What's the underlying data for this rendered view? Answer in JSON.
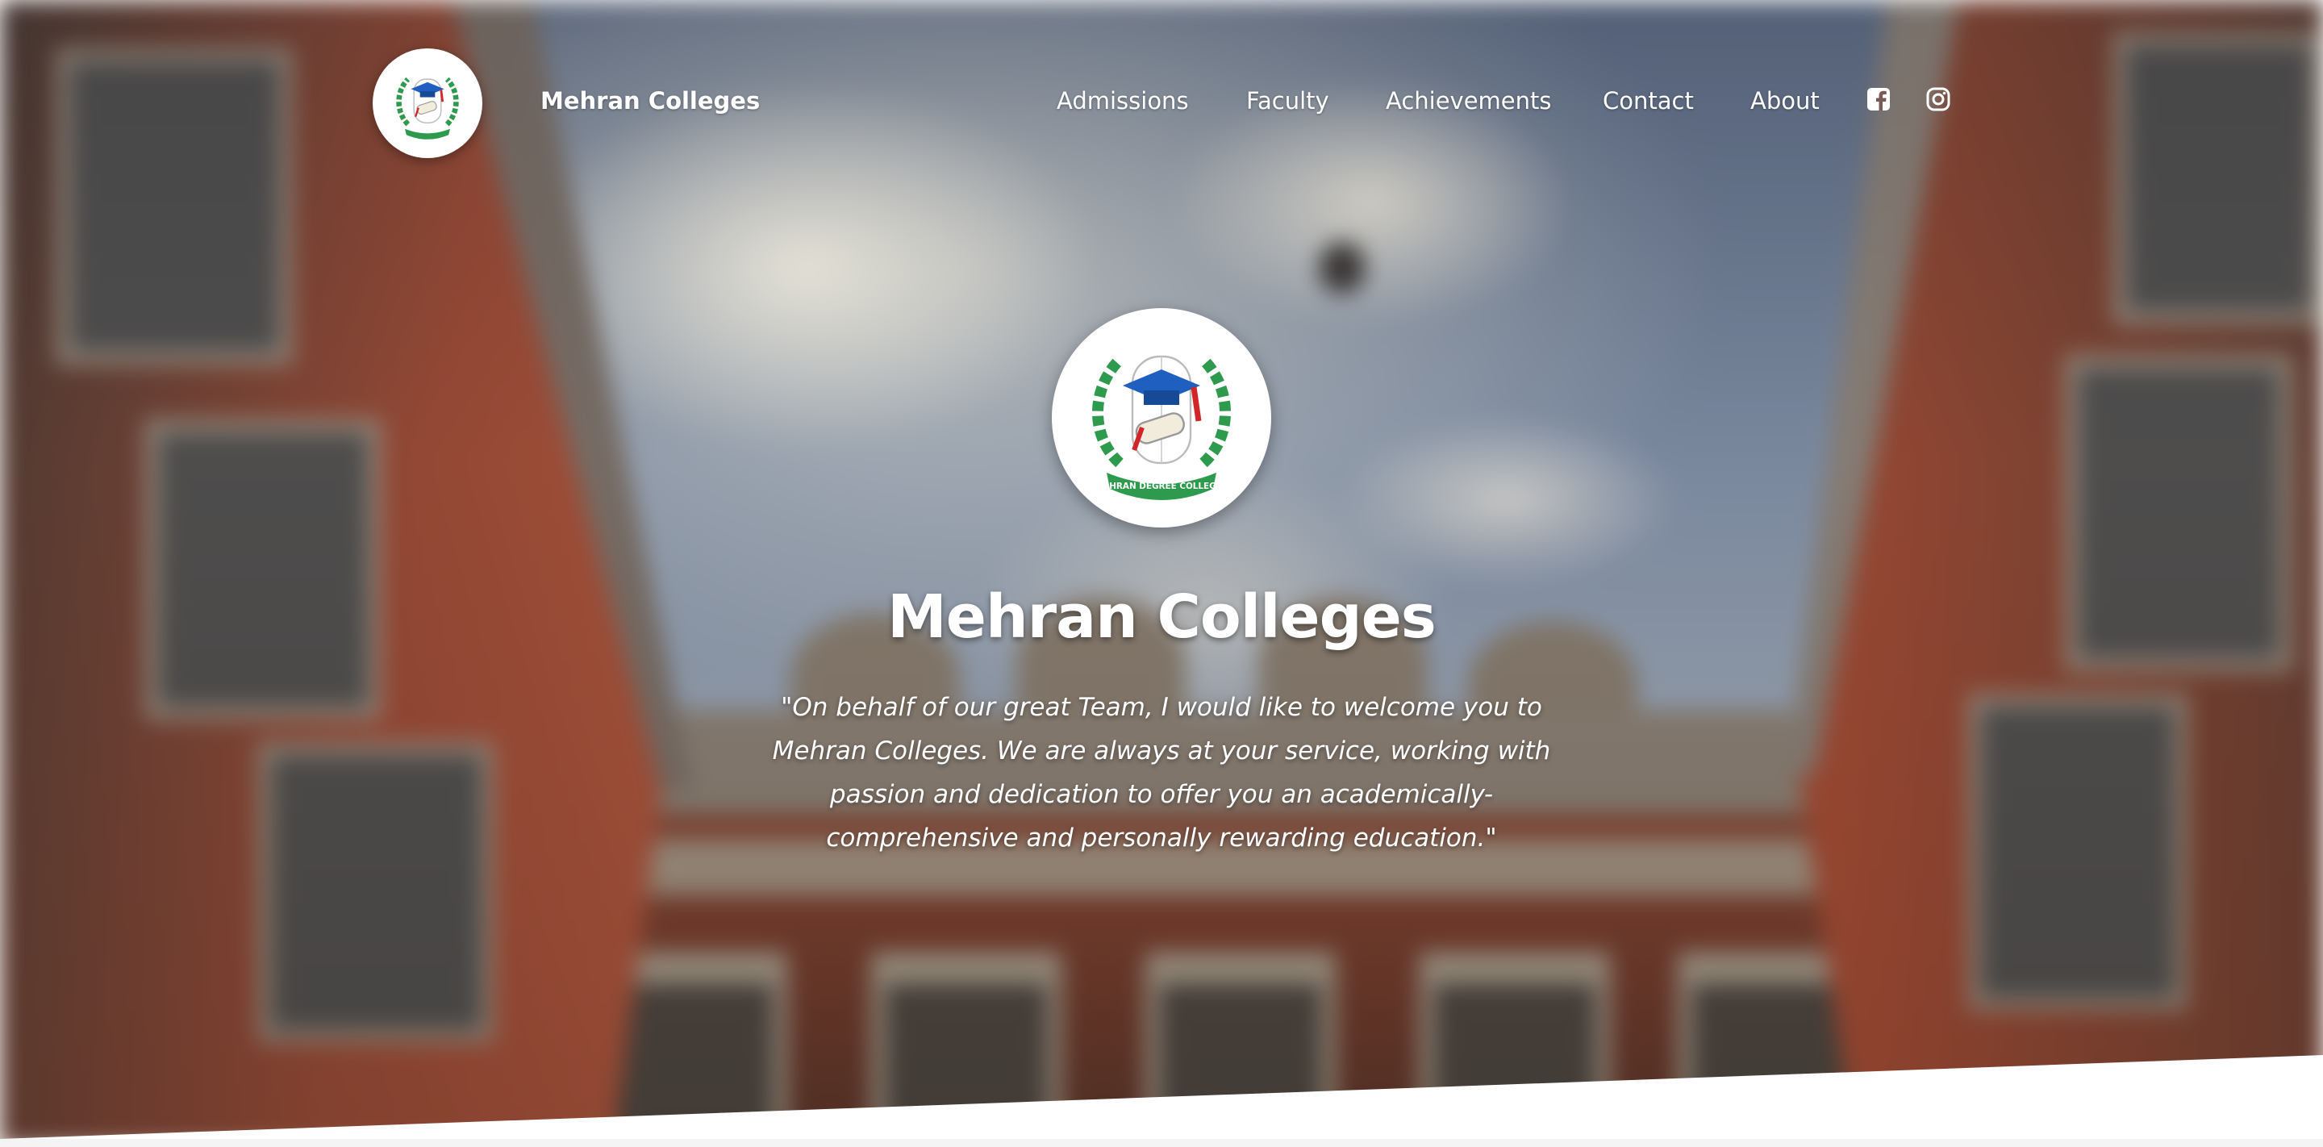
{
  "navbar": {
    "brand": "Mehran Colleges",
    "logo_icon": "college-crest-icon",
    "links": [
      {
        "label": "Admissions"
      },
      {
        "label": "Faculty"
      },
      {
        "label": "Achievements"
      },
      {
        "label": "Contact"
      },
      {
        "label": "About"
      }
    ],
    "social": [
      {
        "icon": "facebook-icon"
      },
      {
        "icon": "instagram-icon"
      }
    ]
  },
  "hero": {
    "logo_icon": "college-crest-icon",
    "logo_text": "MEHRAN DEGREE COLLEGES",
    "title": "Mehran Colleges",
    "quote": "\"On behalf of our great Team, I would like to welcome you to Mehran Colleges. We are always at your service, working with passion and dedication to offer you an academically-comprehensive and personally rewarding education.\""
  },
  "colors": {
    "crest_green": "#2e9a4e",
    "crest_blue": "#1f5fbf",
    "crest_red": "#d0262a",
    "text": "#ffffff"
  }
}
